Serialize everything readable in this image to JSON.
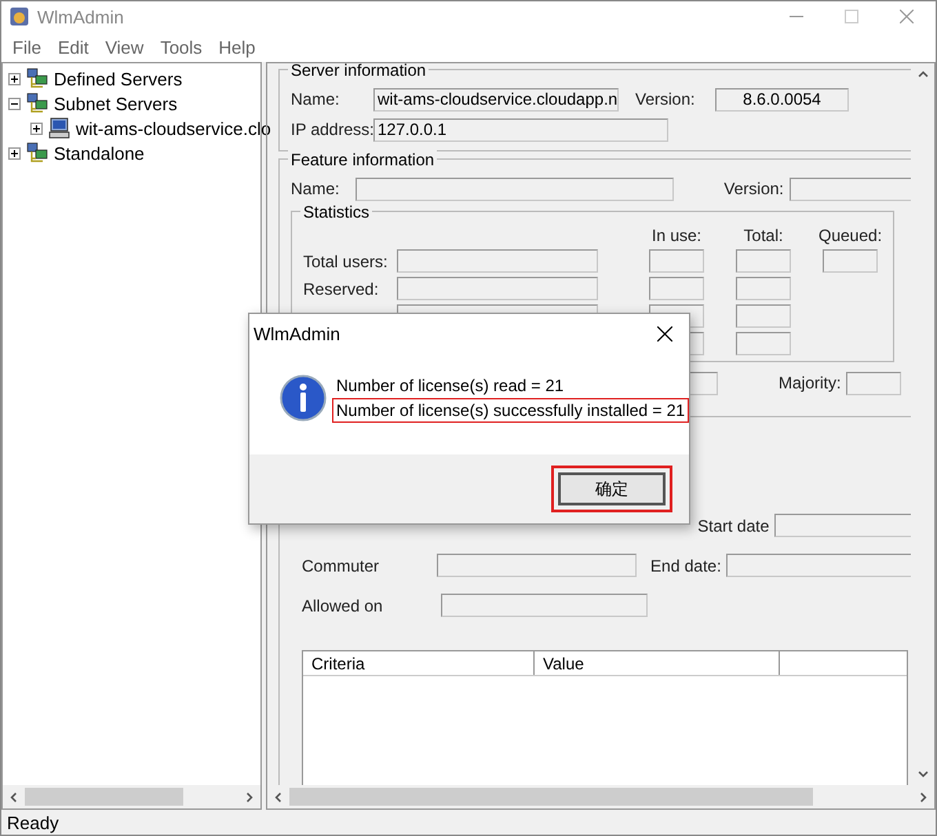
{
  "window": {
    "title": "WlmAdmin"
  },
  "menu": [
    "File",
    "Edit",
    "View",
    "Tools",
    "Help"
  ],
  "tree": [
    {
      "label": "Defined Servers",
      "kind": "group",
      "expanded": false
    },
    {
      "label": "Subnet Servers",
      "kind": "group",
      "expanded": true,
      "children": [
        {
          "label": "wit-ams-cloudservice.clo",
          "kind": "computer",
          "expanded": false
        }
      ]
    },
    {
      "label": "Standalone",
      "kind": "group",
      "expanded": false
    }
  ],
  "server_information": {
    "title": "Server information",
    "name_label": "Name:",
    "name_value": "wit-ams-cloudservice.cloudapp.n",
    "version_label": "Version:",
    "version_value": "8.6.0.0054",
    "ip_label": "IP address:",
    "ip_value": "127.0.0.1"
  },
  "feature_information": {
    "title": "Feature information",
    "name_label": "Name:",
    "version_label": "Version:",
    "statistics": {
      "title": "Statistics",
      "columns": [
        "In use:",
        "Total:",
        "Queued:"
      ],
      "rows": [
        "Total users:",
        "Reserved:"
      ]
    },
    "majority_label": "Majority:"
  },
  "license": {
    "start_label": "Start date",
    "commuter_label": "Commuter",
    "end_label": "End date:",
    "allowed_label": "Allowed on",
    "table_columns": [
      "Criteria",
      "Value"
    ]
  },
  "status_bar": "Ready",
  "dialog": {
    "title": "WlmAdmin",
    "lines": [
      {
        "text": "Number of license(s) read = 21",
        "highlighted": false
      },
      {
        "text": "Number of license(s) successfully installed = 21",
        "highlighted": true
      }
    ],
    "button": {
      "label": "确定",
      "highlighted": true
    }
  }
}
